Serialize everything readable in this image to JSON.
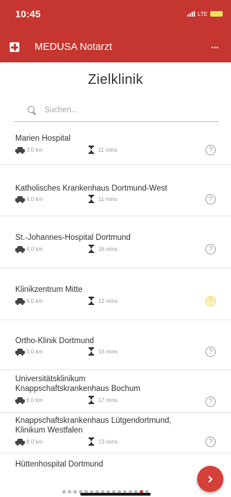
{
  "status_bar": {
    "time": "10:45",
    "network": "LTE",
    "battery_icon": "battery-icon"
  },
  "app_bar": {
    "logo_icon": "medical-cross-icon",
    "title": "MEDUSA Notarzt",
    "menu_label": "···"
  },
  "page_title": "Zielklinik",
  "search": {
    "placeholder": "Suchen..."
  },
  "hospitals": [
    {
      "name": "Marien Hospital",
      "distance": "3.0 km",
      "duration": "11 mins",
      "info": "?"
    },
    {
      "name": "Katholisches Krankenhaus Dortmund-West",
      "distance": "4.0 km",
      "duration": "11 mins",
      "info": "?"
    },
    {
      "name": "St.-Johannes-Hospital Dortmund",
      "distance": "4.0 km",
      "duration": "16 mins",
      "info": "?"
    },
    {
      "name": "Klinikzentrum Mitte",
      "distance": "4.0 km",
      "duration": "12 mins",
      "info": "?"
    },
    {
      "name": "Ortho-Klinik Dortmund",
      "distance": "0.0 km",
      "duration": "16 mins",
      "info": "?"
    },
    {
      "name": "Universitätsklinikum Knappschaftskrankenhaus Bochum",
      "distance": "6.0 km",
      "duration": "17 mins",
      "info": "?"
    },
    {
      "name": "Knappschaftskrankenhaus Lütgendortmund, Klinikum Westfalen",
      "distance": "8.0 km",
      "duration": "13 mins",
      "info": "?"
    },
    {
      "name": "Hüttenhospital Dortmund",
      "distance": "",
      "duration": "",
      "info": ""
    }
  ],
  "colors": {
    "brand_red": "#c4362f",
    "highlight_yellow": "#f2d76a"
  },
  "pager": {
    "total": 16,
    "active_index": 14
  }
}
